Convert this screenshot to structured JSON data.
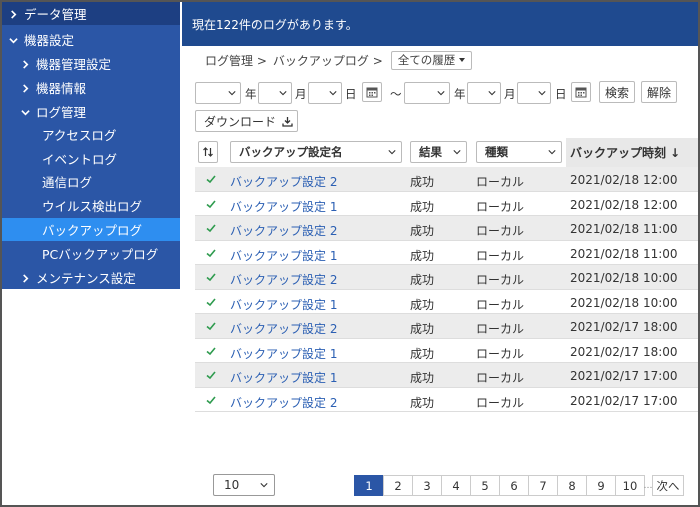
{
  "sidebar": {
    "items": [
      {
        "label": "データ管理",
        "icon": "chevron-right-icon"
      },
      {
        "label": "機器設定",
        "icon": "chevron-down-icon"
      },
      {
        "label": "機器管理設定",
        "icon": "chevron-right-icon"
      },
      {
        "label": "機器情報",
        "icon": "chevron-right-icon"
      },
      {
        "label": "ログ管理",
        "icon": "chevron-down-icon"
      },
      {
        "label": "アクセスログ"
      },
      {
        "label": "イベントログ"
      },
      {
        "label": "通信ログ"
      },
      {
        "label": "ウイルス検出ログ"
      },
      {
        "label": "バックアップログ"
      },
      {
        "label": "PCバックアップログ"
      },
      {
        "label": "メンテナンス設定",
        "icon": "chevron-right-icon"
      }
    ]
  },
  "header": {
    "message": "現在122件のログがあります。"
  },
  "breadcrumb": {
    "part1": "ログ管理 >",
    "part2": "バックアップログ >",
    "history_dropdown": "全ての履歴"
  },
  "filter": {
    "year_label": "年",
    "month_label": "月",
    "day_label": "日",
    "range_sep": "～",
    "search_button": "検索",
    "clear_button": "解除",
    "download_button": "ダウンロード"
  },
  "table": {
    "headers": {
      "name": "バックアップ設定名",
      "result": "結果",
      "kind": "種類",
      "time": "バックアップ時刻"
    },
    "sort_arrow": "↓",
    "rows": [
      {
        "name": "バックアップ設定 2",
        "result": "成功",
        "kind": "ローカル",
        "time": "2021/02/18 12:00"
      },
      {
        "name": "バックアップ設定 1",
        "result": "成功",
        "kind": "ローカル",
        "time": "2021/02/18 12:00"
      },
      {
        "name": "バックアップ設定 2",
        "result": "成功",
        "kind": "ローカル",
        "time": "2021/02/18 11:00"
      },
      {
        "name": "バックアップ設定 1",
        "result": "成功",
        "kind": "ローカル",
        "time": "2021/02/18 11:00"
      },
      {
        "name": "バックアップ設定 2",
        "result": "成功",
        "kind": "ローカル",
        "time": "2021/02/18 10:00"
      },
      {
        "name": "バックアップ設定 1",
        "result": "成功",
        "kind": "ローカル",
        "time": "2021/02/18 10:00"
      },
      {
        "name": "バックアップ設定 2",
        "result": "成功",
        "kind": "ローカル",
        "time": "2021/02/17 18:00"
      },
      {
        "name": "バックアップ設定 1",
        "result": "成功",
        "kind": "ローカル",
        "time": "2021/02/17 18:00"
      },
      {
        "name": "バックアップ設定 1",
        "result": "成功",
        "kind": "ローカル",
        "time": "2021/02/17 17:00"
      },
      {
        "name": "バックアップ設定 2",
        "result": "成功",
        "kind": "ローカル",
        "time": "2021/02/17 17:00"
      }
    ]
  },
  "footer": {
    "per_page": "10",
    "pages": [
      "1",
      "2",
      "3",
      "4",
      "5",
      "6",
      "7",
      "8",
      "9",
      "10"
    ],
    "current_page": "1",
    "next_label": "次へ"
  },
  "colors": {
    "sidebar": "#2b56a6",
    "sidebar_active": "#2e8ef0",
    "header": "#1f4a8f",
    "link": "#2b5fb3",
    "check": "#2e9b4e"
  }
}
